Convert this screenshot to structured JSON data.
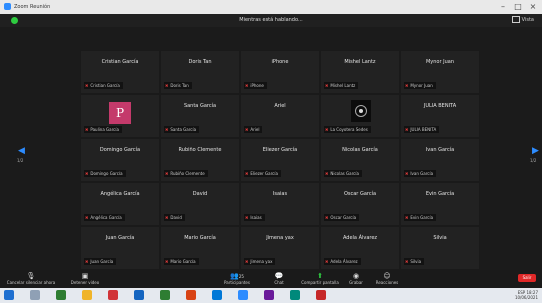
{
  "window": {
    "title": "Zoom Reunión"
  },
  "topbar": {
    "viewing": "Mientras está hablando...",
    "view_label": "Vista"
  },
  "page": {
    "left_num": "1/2",
    "right_num": "1/2"
  },
  "tiles": [
    {
      "name": "Cristian García",
      "label": "Cristian García"
    },
    {
      "name": "Doris Tan",
      "label": "Doris Tan"
    },
    {
      "name": "iPhone",
      "label": "iPhone"
    },
    {
      "name": "Mishel Lantz",
      "label": "Mishel Lantz"
    },
    {
      "name": "Mynor Juan",
      "label": "Mynor Juan"
    },
    {
      "name": "",
      "label": "Paulina García",
      "avatar": "P"
    },
    {
      "name": "Santa García",
      "label": "Santa García"
    },
    {
      "name": "Ariel",
      "label": "Ariel"
    },
    {
      "name": "",
      "label": "La Coyotera Sedes",
      "photo": true
    },
    {
      "name": "JULIA BENITA",
      "label": "JULIA BENITA"
    },
    {
      "name": "Domingo García",
      "label": "Domingo García"
    },
    {
      "name": "Rubiño Clemente",
      "label": "Rubiño Clemente"
    },
    {
      "name": "Eliezer García",
      "label": "Eliezer García"
    },
    {
      "name": "Nicolas García",
      "label": "Nicolas García"
    },
    {
      "name": "Ivan García",
      "label": "Ivan García"
    },
    {
      "name": "Angélica García",
      "label": "Angélica García"
    },
    {
      "name": "David",
      "label": "David"
    },
    {
      "name": "Isaias",
      "label": "Isaias"
    },
    {
      "name": "Oscar García",
      "label": "Oscar García"
    },
    {
      "name": "Evin García",
      "label": "Evin García"
    },
    {
      "name": "Juan García",
      "label": "Juan García"
    },
    {
      "name": "Mario García",
      "label": "Mario García"
    },
    {
      "name": "Jimena yax",
      "label": "Jimena yax"
    },
    {
      "name": "Adela Álvarez",
      "label": "Adela Álvarez"
    },
    {
      "name": "Silvia",
      "label": "Silvia"
    }
  ],
  "toolbar": {
    "audio": "Cancelar silenciar ahora",
    "video": "Detener video",
    "participants": "Participantes",
    "participants_count": "25",
    "chat": "Chat",
    "share": "Compartir pantalla",
    "record": "Grabar",
    "reactions": "Reacciones",
    "leave": "Salir",
    "accent": "#2ecc40",
    "leave_color": "#e02828"
  },
  "taskbar": {
    "time": "18:27",
    "date": "10/06/2021",
    "lang": "ESP"
  }
}
